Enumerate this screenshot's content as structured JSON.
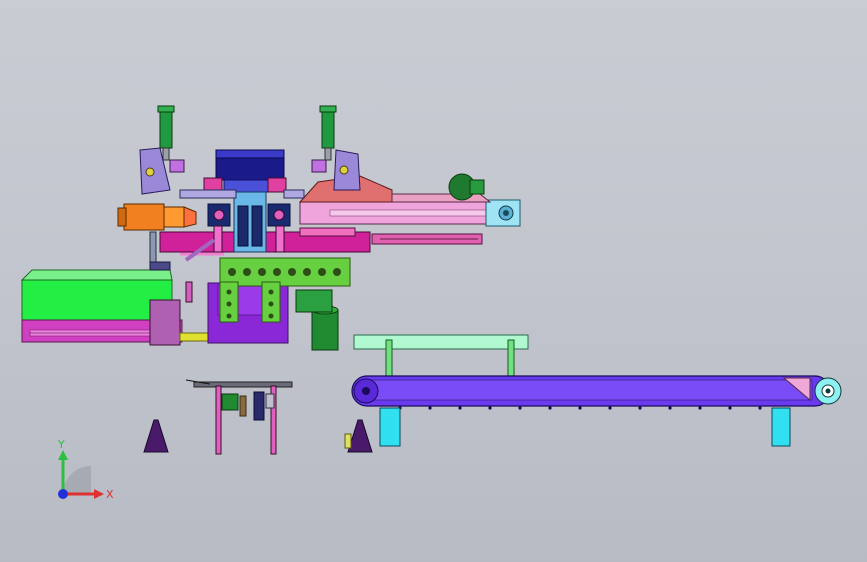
{
  "viewport": {
    "background_top": "#c9ccd3",
    "background_bottom": "#b7bbc4"
  },
  "triad": {
    "x_label": "X",
    "y_label": "Y",
    "x_color": "#e03030",
    "y_color": "#2fbf40",
    "z_color": "#2330d8"
  },
  "model": {
    "description_icon": "cad-assembly-icon"
  }
}
